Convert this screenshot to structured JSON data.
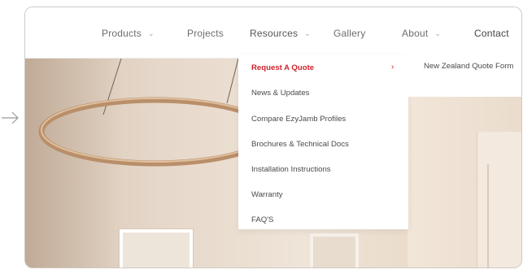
{
  "nav": {
    "products": "Products",
    "projects": "Projects",
    "resources": "Resources",
    "gallery": "Gallery",
    "about": "About",
    "contact": "Contact"
  },
  "icons": {
    "side_arrow": "arrow-right-icon",
    "dropdown_chevron": "chevron-down-icon",
    "submenu_chevron": "chevron-right-icon"
  },
  "colors": {
    "accent": "#d0222b",
    "nav_text": "#6d6d6d"
  },
  "resources_menu": {
    "items": [
      "Request A Quote",
      "News & Updates",
      "Compare EzyJamb Profiles",
      "Brochures & Technical Docs",
      "Installation Instructions",
      "Warranty",
      "FAQ'S"
    ],
    "active_index": 0
  },
  "submenu": {
    "items": [
      "New Zealand Quote Form"
    ]
  }
}
